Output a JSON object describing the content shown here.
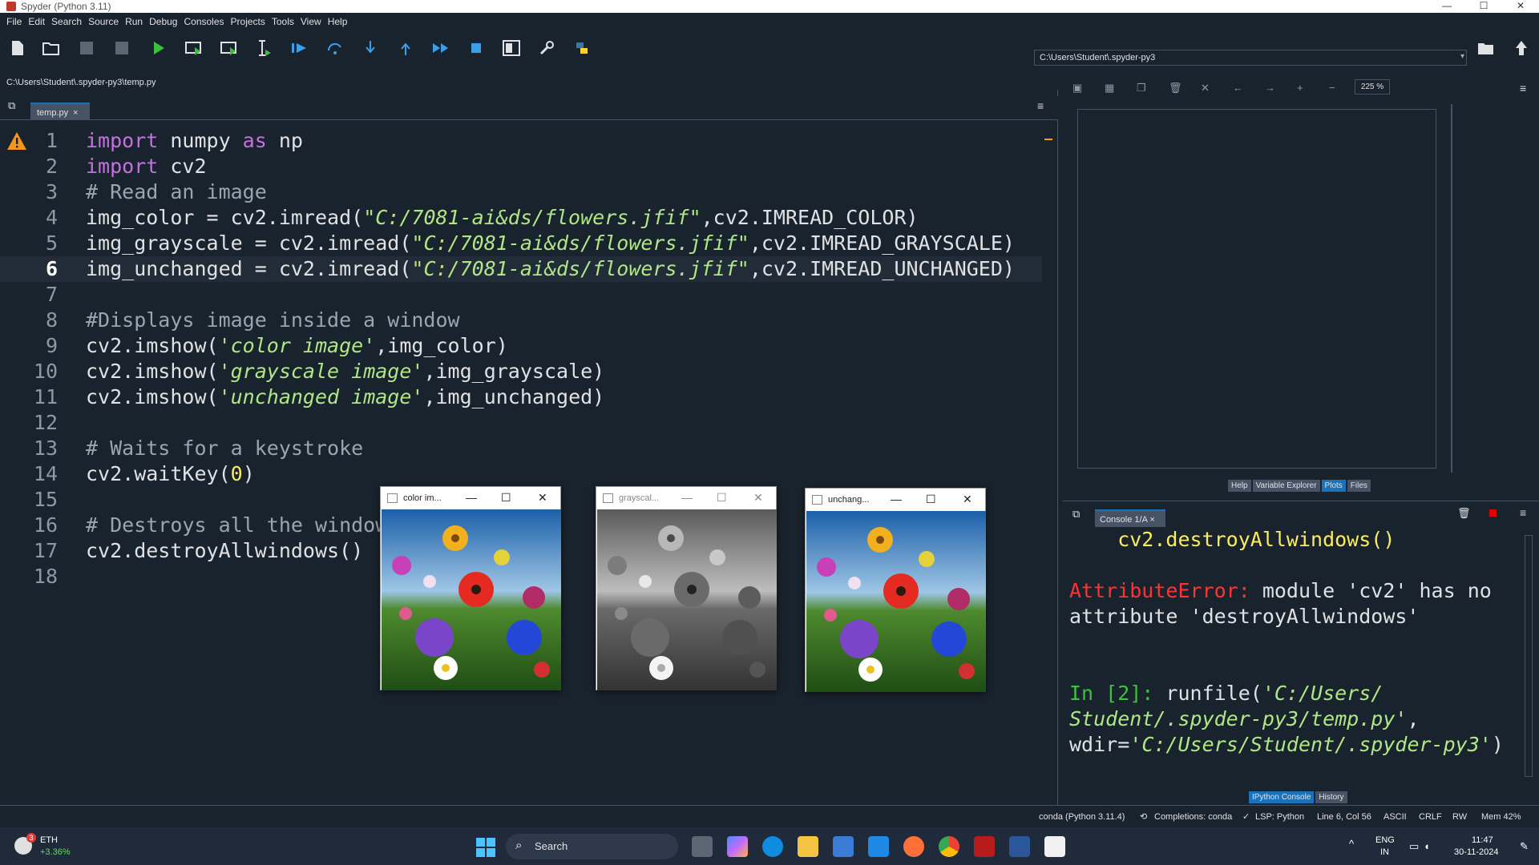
{
  "window": {
    "title": "Spyder (Python 3.11)",
    "controls": [
      "—",
      "☐",
      "✕"
    ]
  },
  "menu": [
    "File",
    "Edit",
    "Search",
    "Source",
    "Run",
    "Debug",
    "Consoles",
    "Projects",
    "Tools",
    "View",
    "Help"
  ],
  "toolbar": {
    "path": "C:\\Users\\Student\\.spyder-py3"
  },
  "editor": {
    "filepath": "C:\\Users\\Student\\.spyder-py3\\temp.py",
    "tab": "temp.py",
    "current_line": 6,
    "lines": [
      {
        "n": "1",
        "html": ""
      },
      {
        "n": "2",
        "html": ""
      },
      {
        "n": "3",
        "html": ""
      },
      {
        "n": "4",
        "html": ""
      },
      {
        "n": "5",
        "html": ""
      },
      {
        "n": "6",
        "html": ""
      },
      {
        "n": "7",
        "html": ""
      },
      {
        "n": "8",
        "html": ""
      },
      {
        "n": "9",
        "html": ""
      },
      {
        "n": "10",
        "html": ""
      },
      {
        "n": "11",
        "html": ""
      },
      {
        "n": "12",
        "html": ""
      },
      {
        "n": "13",
        "html": ""
      },
      {
        "n": "14",
        "html": ""
      },
      {
        "n": "15",
        "html": ""
      },
      {
        "n": "16",
        "html": ""
      },
      {
        "n": "17",
        "html": ""
      },
      {
        "n": "18",
        "html": ""
      }
    ],
    "code": {
      "l1": [
        "import",
        " numpy ",
        "as",
        " np"
      ],
      "l2": [
        "import",
        " cv2"
      ],
      "l3": "# Read an image",
      "l4": [
        "img_color = cv2.imread(",
        "\"C:/7081-ai&ds/flowers.jfif\"",
        ",cv2.IMREAD_COLOR)"
      ],
      "l5": [
        "img_grayscale = cv2.imread(",
        "\"C:/7081-ai&ds/flowers.jfif\"",
        ",cv2.IMREAD_GRAYSCALE)"
      ],
      "l6": [
        "img_unchanged = cv2.imread(",
        "\"C:/7081-ai&ds/flowers.jfif\"",
        ",cv2.IMREAD_UNCHANGED)"
      ],
      "l8": "#Displays image inside a window",
      "l9": [
        "cv2.imshow(",
        "'color image'",
        ",img_color)"
      ],
      "l10": [
        "cv2.imshow(",
        "'grayscale image'",
        ",img_grayscale)"
      ],
      "l11": [
        "cv2.imshow(",
        "'unchanged image'",
        ",img_unchanged)"
      ],
      "l13": "# Waits for a keystroke",
      "l14": [
        "cv2.waitKey(",
        "0",
        ")"
      ],
      "l16": "# Destroys all the window",
      "l17": "cv2.destroyAllwindows()"
    }
  },
  "plots": {
    "zoom": "225 %",
    "tabs": [
      "Help",
      "Variable Explorer",
      "Plots",
      "Files"
    ],
    "active_tab": "Plots"
  },
  "console": {
    "tab": "Console 1/A",
    "lines": {
      "a": "    cv2.destroyAllwindows()",
      "err_name": "AttributeError:",
      "err_msg1": " module 'cv2' has no",
      "err_msg2": "attribute 'destroyAllwindows'",
      "prompt": "In [2]:",
      "prompt_num": "2",
      "run1": " runfile(",
      "run_str1": "'C:/Users/",
      "run_str2": "Student/.spyder-py3/temp.py'",
      "run_comma": ",",
      "wdir": "wdir=",
      "wdir_str": "'C:/Users/Student/.spyder-py3'",
      "close": ")"
    },
    "bottom_tabs": [
      "IPython Console",
      "History"
    ],
    "active_tab": "IPython Console"
  },
  "status": {
    "env": "conda (Python 3.11.4)",
    "completions": "Completions: conda",
    "lsp": "LSP: Python",
    "pos": "Line 6, Col 56",
    "enc": "ASCII",
    "eol": "CRLF",
    "rw": "RW",
    "mem": "Mem 42%"
  },
  "cv_windows": [
    {
      "title": "color im...",
      "mode": "color"
    },
    {
      "title": "grayscal...",
      "mode": "gray"
    },
    {
      "title": "unchang...",
      "mode": "color"
    }
  ],
  "taskbar": {
    "ticker_name": "ETH",
    "ticker_change": "+3.36%",
    "badge": "3",
    "search": "Search",
    "lang1": "ENG",
    "lang2": "IN",
    "time": "11:47",
    "date": "30-11-2024"
  }
}
